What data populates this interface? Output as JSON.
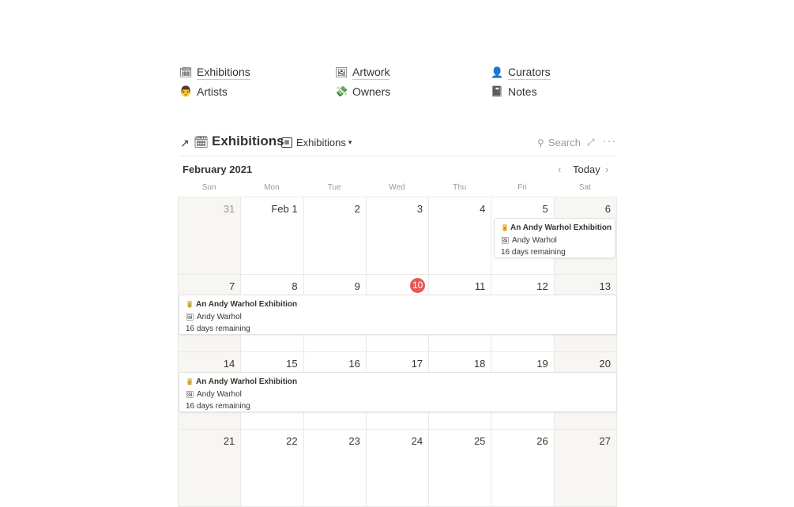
{
  "links": [
    {
      "label": "Exhibitions",
      "icon": "calendar-icon",
      "glyph": "🗓"
    },
    {
      "label": "Artwork",
      "icon": "framed-picture-icon",
      "glyph": "🖼"
    },
    {
      "label": "Curators",
      "icon": "person-icon",
      "glyph": "👤"
    },
    {
      "label": "Artists",
      "icon": "artist-icon",
      "glyph": "👨"
    },
    {
      "label": "Owners",
      "icon": "money-icon",
      "glyph": "💸"
    },
    {
      "label": "Notes",
      "icon": "notebook-icon",
      "glyph": "📓"
    }
  ],
  "database": {
    "title": "Exhibitions",
    "icon_glyph": "🗓",
    "open_glyph": "↗",
    "view_label": "Exhibitions",
    "search_label": "Search",
    "expand_glyph": "⤢",
    "more_glyph": "···"
  },
  "calendar": {
    "month_label": "February 2021",
    "today_label": "Today",
    "prev_glyph": "‹",
    "next_glyph": "›",
    "weekdays": [
      "Sun",
      "Mon",
      "Tue",
      "Wed",
      "Thu",
      "Fri",
      "Sat"
    ],
    "today_number": "10",
    "weeks": [
      [
        "31",
        "Feb 1",
        "2",
        "3",
        "4",
        "5",
        "6"
      ],
      [
        "7",
        "8",
        "9",
        "10",
        "11",
        "12",
        "13"
      ],
      [
        "14",
        "15",
        "16",
        "17",
        "18",
        "19",
        "20"
      ],
      [
        "21",
        "22",
        "23",
        "24",
        "25",
        "26",
        "27"
      ]
    ],
    "event": {
      "title": "An Andy Warhol Exhibition",
      "artist": "Andy Warhol",
      "remaining": "16 days remaining",
      "title_glyph": "🥫",
      "artist_glyph": "🖼"
    }
  }
}
